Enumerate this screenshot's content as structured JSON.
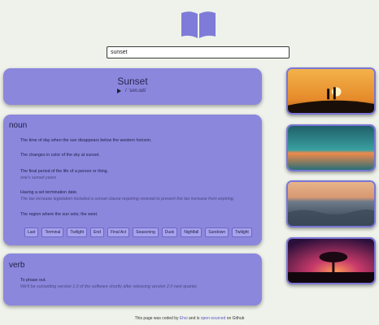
{
  "search": {
    "value": "sunset"
  },
  "header": {
    "word": "Sunset",
    "pronunciation": "/ ˈsʌn.sɛt/"
  },
  "noun": {
    "title": "noun",
    "definitions": [
      {
        "text": "The time of day when the sun disappears below the western horizon.",
        "example": ""
      },
      {
        "text": "The changes in color of the sky at sunset.",
        "example": ""
      },
      {
        "text": "The final period of the life of a person or thing.",
        "example": "one's sunset years"
      },
      {
        "text": "Having a set termination date.",
        "example": "The tax increase legislation included a sunset clause requiring renewal to prevent the tax increase from expiring."
      },
      {
        "text": "The region where the sun sets; the west.",
        "example": ""
      }
    ],
    "synonyms": [
      "Last",
      "Terminal",
      "Twilight",
      "End",
      "Final Act",
      "Seasoning",
      "Dusk",
      "Nightfall",
      "Sundown",
      "Twilight"
    ]
  },
  "verb": {
    "title": "verb",
    "definitions": [
      {
        "text": "To phase out.",
        "example": "We'll be sunsetting version 1.0 of the software shortly after releasing version 2.0 next quarter."
      }
    ]
  },
  "footer": {
    "prefix": "This page was coded by",
    "author": "Ehsi",
    "middle": "and is",
    "link": "open-sourced",
    "suffix": "on Github"
  },
  "colors": {
    "card": "#8b87dd",
    "background": "#eef2ea",
    "accent": "#7a76d6"
  },
  "icons": {
    "logo": "open-book-icon",
    "play": "play-icon"
  }
}
